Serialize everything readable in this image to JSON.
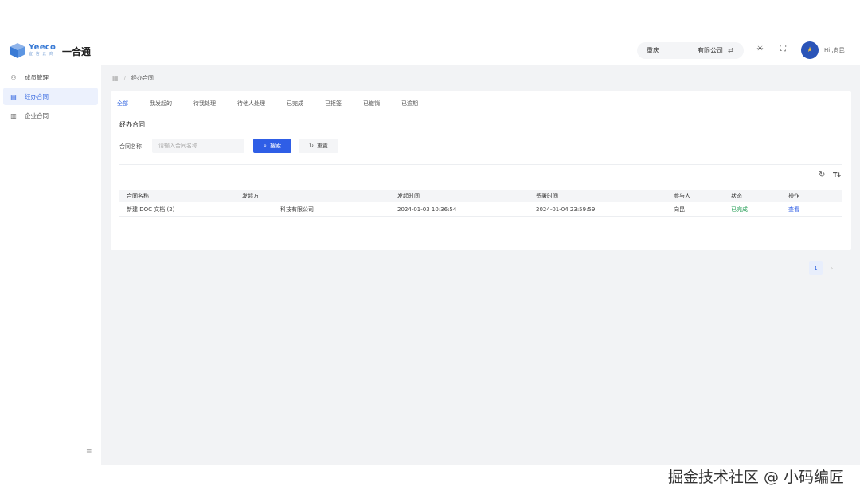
{
  "header": {
    "logo_brand": "Yeeco",
    "logo_sub": "宜 信 云 商",
    "app_name": "一合通",
    "tenant_city": "重庆",
    "tenant_company": "有限公司",
    "greeting": "Hi ,向昆"
  },
  "sidebar": {
    "items": [
      {
        "label": "成员管理",
        "icon": "users-icon"
      },
      {
        "label": "经办合同",
        "icon": "document-icon"
      },
      {
        "label": "企业合同",
        "icon": "book-icon"
      }
    ]
  },
  "breadcrumb": {
    "current": "经办合同"
  },
  "tabs": [
    "全部",
    "我发起的",
    "待我处理",
    "待他人处理",
    "已完成",
    "已拒签",
    "已撤销",
    "已逾期"
  ],
  "section_title": "经办合同",
  "filter": {
    "label": "合同名称",
    "placeholder": "请输入合同名称",
    "search_label": "搜索",
    "reset_label": "重置"
  },
  "table": {
    "columns": [
      "合同名称",
      "发起方",
      "发起时间",
      "签署时间",
      "参与人",
      "状态",
      "操作"
    ],
    "rows": [
      {
        "name": "新建 DOC 文档 (2)",
        "initiator": "科技有限公司",
        "start_time": "2024-01-03 10:36:54",
        "sign_time": "2024-01-04 23:59:59",
        "participant": "向昆",
        "status": "已完成",
        "action": "查看"
      }
    ]
  },
  "pagination": {
    "current": "1"
  },
  "watermark": "掘金技术社区 @ 小码编匠",
  "colors": {
    "primary": "#2f5ee6",
    "success": "#2aa05a",
    "background": "#f2f3f5"
  }
}
